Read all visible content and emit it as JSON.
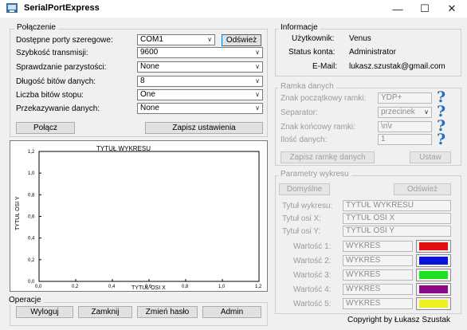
{
  "window": {
    "title": "SerialPortExpress"
  },
  "polaczenie": {
    "title": "Połączenie",
    "port_label": "Dostępne porty szeregowe:",
    "port_value": "COM1",
    "refresh_label": "Odśwież",
    "speed_label": "Szybkość transmisji:",
    "speed_value": "9600",
    "parity_label": "Sprawdzanie parzystości:",
    "parity_value": "None",
    "databits_label": "Długość bitów danych:",
    "databits_value": "8",
    "stopbits_label": "Liczba bitów stopu:",
    "stopbits_value": "One",
    "handshake_label": "Przekazywanie danych:",
    "handshake_value": "None",
    "connect_label": "Połącz",
    "save_label": "Zapisz ustawienia"
  },
  "chart_data": {
    "type": "line",
    "title": "TYTUŁ WYKRESU",
    "xlabel": "TYTUŁ OSI X",
    "ylabel": "TYTUŁ OSI Y",
    "xlim": [
      0,
      1.2
    ],
    "ylim": [
      0,
      1.2
    ],
    "xticks": [
      "0,0",
      "0,2",
      "0,4",
      "0,6",
      "0,8",
      "1,0",
      "1,2"
    ],
    "yticks": [
      "0,0",
      "0,2",
      "0,4",
      "0,6",
      "0,8",
      "1,0",
      "1,2"
    ],
    "series": []
  },
  "operacje": {
    "title": "Operacje",
    "buttons": [
      "Wyloguj",
      "Zamknij",
      "Zmień hasło",
      "Admin"
    ]
  },
  "informacje": {
    "title": "Informacje",
    "user_label": "Użytkownik:",
    "user_value": "Venus",
    "status_label": "Status konta:",
    "status_value": "Administrator",
    "email_label": "E-Mail:",
    "email_value": "lukasz.szustak@gmail.com"
  },
  "ramka": {
    "title": "Ramka danych",
    "start_label": "Znak początkowy ramki:",
    "start_value": "YDP+",
    "sep_label": "Separator:",
    "sep_value": "przecinek",
    "end_label": "Znak końcowy ramki:",
    "end_value": "\\n\\r",
    "count_label": "Ilość danych:",
    "count_value": "1",
    "help_glyph": "?",
    "apply_label": "Zapisz ramkę danych",
    "set_label": "Ustaw"
  },
  "parametry": {
    "title": "Parametry wykresu",
    "default_label": "Domyślne",
    "refresh_label": "Odśwież",
    "chart_title_label": "Tytuł wykresu:",
    "chart_title_value": "TYTUŁ WYKRESU",
    "x_label": "Tytuł osi X:",
    "x_value": "TYTUŁ OSI X",
    "y_label": "Tytuł osi Y:",
    "y_value": "TYTUŁ OSI Y",
    "series": [
      {
        "label": "Wartość 1:",
        "name": "WYKRES",
        "color": "#e01010"
      },
      {
        "label": "Wartość 2:",
        "name": "WYKRES",
        "color": "#0a14d8"
      },
      {
        "label": "Wartość 3:",
        "name": "WYKRES",
        "color": "#20e020"
      },
      {
        "label": "Wartość 4:",
        "name": "WYKRES",
        "color": "#8a0a8a"
      },
      {
        "label": "Wartość 5:",
        "name": "WYKRES",
        "color": "#f0f020"
      }
    ]
  },
  "footer": {
    "copyright": "Copyright by Łukasz Szustak"
  }
}
